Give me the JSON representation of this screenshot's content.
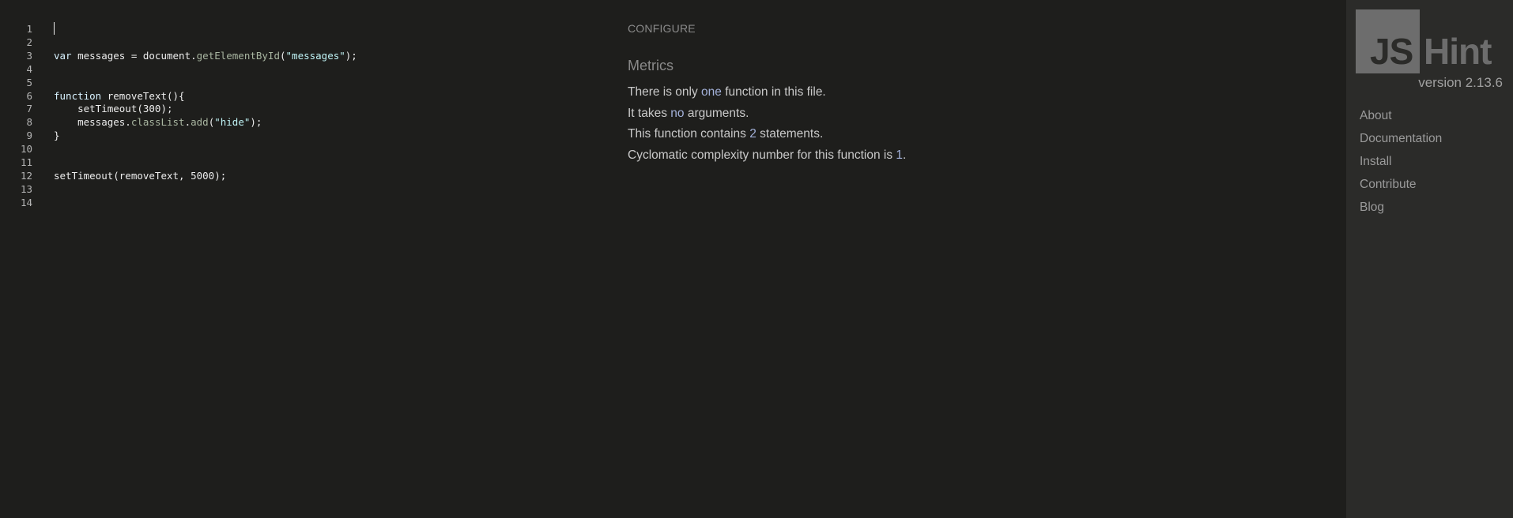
{
  "editor": {
    "lines": [
      {
        "num": "1",
        "tokens": []
      },
      {
        "num": "2",
        "tokens": []
      },
      {
        "num": "3",
        "tokens": [
          {
            "t": "var",
            "c": "kw"
          },
          {
            "t": " messages = document.",
            "c": "plain"
          },
          {
            "t": "getElementById",
            "c": "prop"
          },
          {
            "t": "(",
            "c": "plain"
          },
          {
            "t": "\"messages\"",
            "c": "str"
          },
          {
            "t": ");",
            "c": "plain"
          }
        ]
      },
      {
        "num": "4",
        "tokens": []
      },
      {
        "num": "5",
        "tokens": []
      },
      {
        "num": "6",
        "tokens": [
          {
            "t": "function",
            "c": "kw"
          },
          {
            "t": " removeText(){",
            "c": "plain"
          }
        ]
      },
      {
        "num": "7",
        "tokens": [
          {
            "t": "    setTimeout(300);",
            "c": "plain"
          }
        ]
      },
      {
        "num": "8",
        "tokens": [
          {
            "t": "    messages.",
            "c": "plain"
          },
          {
            "t": "classList",
            "c": "prop"
          },
          {
            "t": ".",
            "c": "plain"
          },
          {
            "t": "add",
            "c": "prop"
          },
          {
            "t": "(",
            "c": "plain"
          },
          {
            "t": "\"hide\"",
            "c": "str"
          },
          {
            "t": ");",
            "c": "plain"
          }
        ]
      },
      {
        "num": "9",
        "tokens": [
          {
            "t": "}",
            "c": "plain"
          }
        ]
      },
      {
        "num": "10",
        "tokens": []
      },
      {
        "num": "11",
        "tokens": []
      },
      {
        "num": "12",
        "tokens": [
          {
            "t": "setTimeout(removeText, 5000);",
            "c": "plain"
          }
        ]
      },
      {
        "num": "13",
        "tokens": []
      },
      {
        "num": "14",
        "tokens": []
      }
    ]
  },
  "report": {
    "configure_label": "CONFIGURE",
    "metrics_title": "Metrics",
    "metrics": [
      {
        "parts": [
          {
            "t": "There is only ",
            "hl": false
          },
          {
            "t": "one",
            "hl": true
          },
          {
            "t": " function in this file.",
            "hl": false
          }
        ]
      },
      {
        "parts": [
          {
            "t": "It takes ",
            "hl": false
          },
          {
            "t": "no",
            "hl": true
          },
          {
            "t": " arguments.",
            "hl": false
          }
        ]
      },
      {
        "parts": [
          {
            "t": "This function contains ",
            "hl": false
          },
          {
            "t": "2",
            "hl": true
          },
          {
            "t": " statements.",
            "hl": false
          }
        ]
      },
      {
        "parts": [
          {
            "t": "Cyclomatic complexity number for this function is ",
            "hl": false
          },
          {
            "t": "1",
            "hl": true
          },
          {
            "t": ".",
            "hl": false
          }
        ]
      }
    ]
  },
  "sidebar": {
    "logo_js": "JS",
    "logo_hint": "Hint",
    "version": "version 2.13.6",
    "nav": [
      {
        "label": "About"
      },
      {
        "label": "Documentation"
      },
      {
        "label": "Install"
      },
      {
        "label": "Contribute"
      },
      {
        "label": "Blog"
      }
    ]
  },
  "colors": {
    "background": "#1e1e1c",
    "sidebar_background": "#2b2b29",
    "keyword": "#d8f2ff",
    "property": "#a9b6a1",
    "string": "#bff3f5",
    "highlight": "#a3b1d9",
    "logo_gray": "#6d6d6d"
  }
}
